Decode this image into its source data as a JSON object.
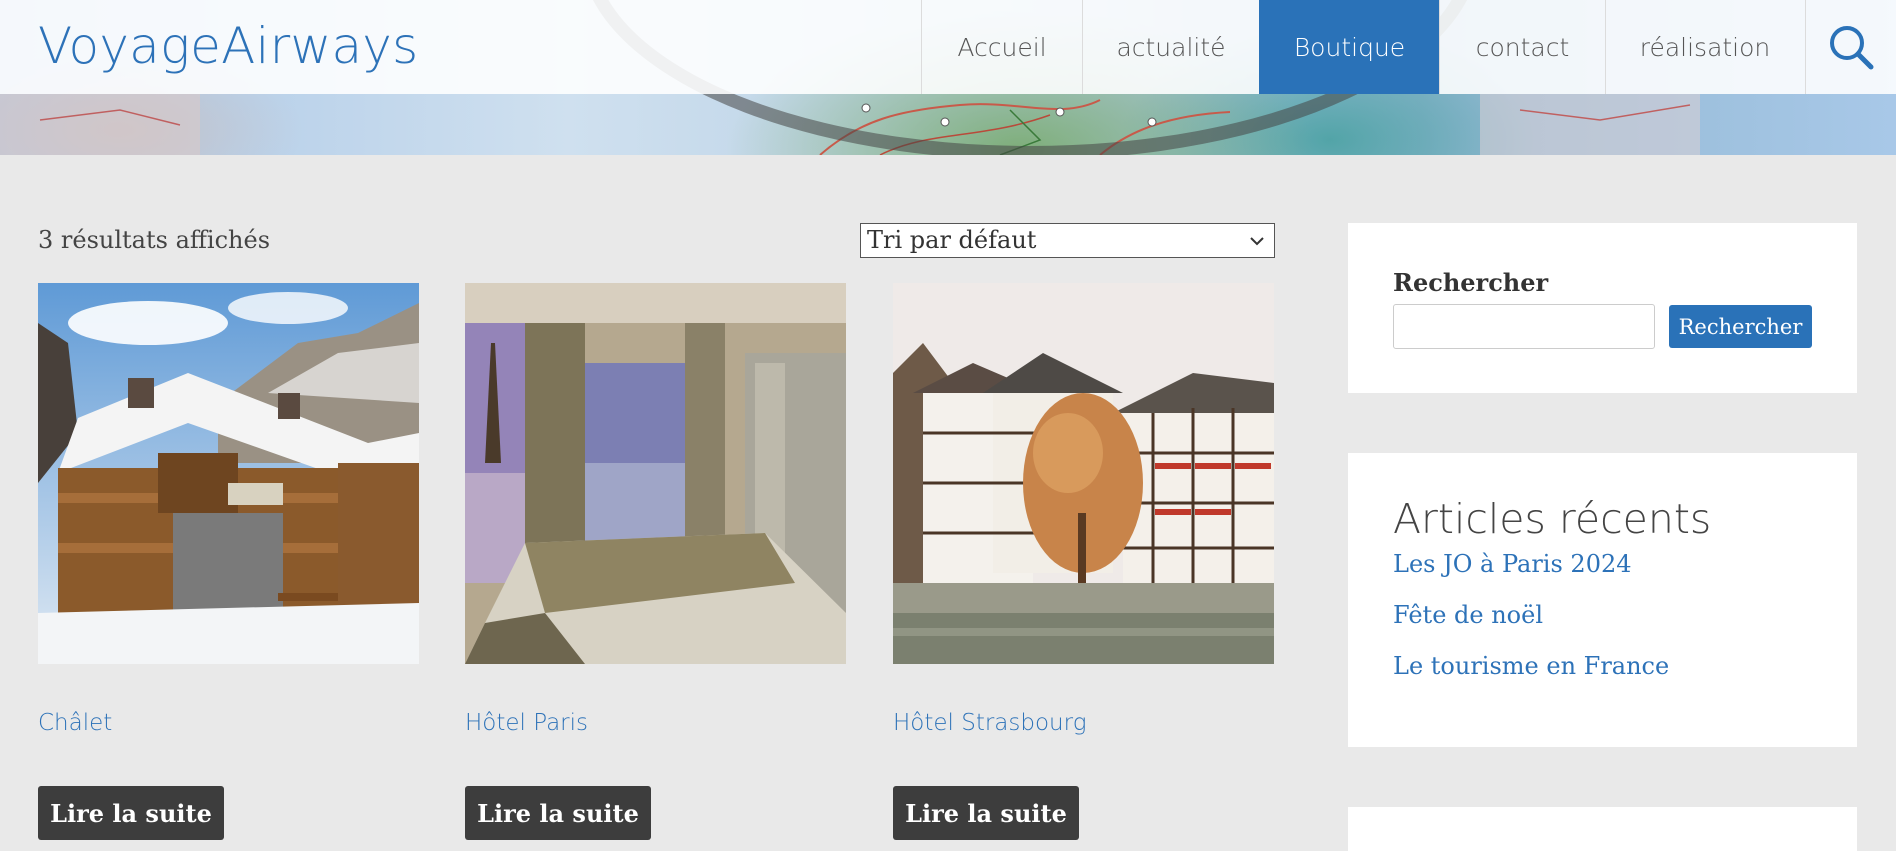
{
  "site": {
    "logo": "VoyageAirways"
  },
  "nav": {
    "items": [
      {
        "label": "Accueil",
        "active": false
      },
      {
        "label": "actualité",
        "active": false
      },
      {
        "label": "Boutique",
        "active": true
      },
      {
        "label": "contact",
        "active": false
      },
      {
        "label": "réalisation",
        "active": false
      }
    ],
    "search_icon": "search-icon"
  },
  "shop": {
    "result_count": "3 résultats affichés",
    "sort": {
      "selected": "Tri par défaut",
      "icon": "chevron-down-icon"
    },
    "products": [
      {
        "title": "Châlet",
        "button": "Lire la suite"
      },
      {
        "title": "Hôtel Paris",
        "button": "Lire la suite"
      },
      {
        "title": "Hôtel Strasbourg",
        "button": "Lire la suite"
      }
    ]
  },
  "sidebar": {
    "search": {
      "label": "Rechercher",
      "input_value": "",
      "button": "Rechercher"
    },
    "recent": {
      "title": "Articles récents",
      "items": [
        "Les JO à Paris 2024",
        "Fête de noël",
        "Le tourisme en France"
      ]
    }
  },
  "colors": {
    "accent": "#2a72b8",
    "button_dark": "#3d3d3d",
    "background": "#e9e9e9"
  }
}
